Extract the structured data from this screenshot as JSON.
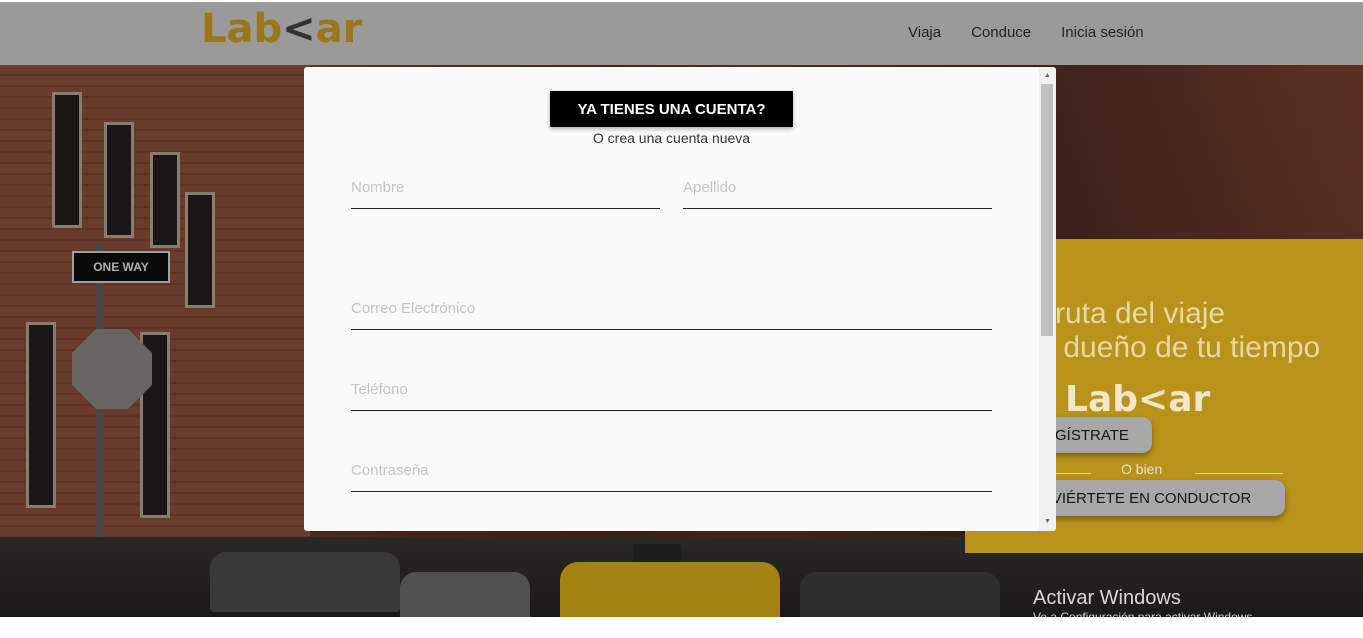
{
  "header": {
    "logo_text": "Lab",
    "logo_mark": "<",
    "logo_suffix": "ar",
    "nav": [
      "Viaja",
      "Conduce",
      "Inicia sesión"
    ]
  },
  "background": {
    "street_sign": "ONE WAY"
  },
  "promo": {
    "line1": "ruta del viaje",
    "line2": "s dueño de tu tiempo",
    "logo_text": "Lab",
    "logo_mark": "<",
    "logo_suffix": "ar",
    "register_label": "GÍSTRATE",
    "or_label": "O bien",
    "driver_label": "NVIÉRTETE EN CONDUCTOR"
  },
  "modal": {
    "login_button": "YA TIENES UNA CUENTA?",
    "subtitle": "O crea una cuenta nueva",
    "fields": {
      "first_name": {
        "placeholder": "Nombre",
        "value": ""
      },
      "last_name": {
        "placeholder": "Apellido",
        "value": ""
      },
      "email": {
        "placeholder": "Correo Electrónico",
        "value": ""
      },
      "phone": {
        "placeholder": "Teléfono",
        "value": ""
      },
      "password": {
        "placeholder": "Contraseña",
        "value": ""
      }
    }
  },
  "os_watermark": {
    "title": "Activar Windows",
    "subtitle": "Ve a Configuración para activar Windows."
  },
  "colors": {
    "brand": "#9c7617",
    "promo_bg": "#b9921a",
    "header_bg": "#9a9a9a",
    "modal_bg": "#fafafa",
    "button_dark": "#000000"
  }
}
